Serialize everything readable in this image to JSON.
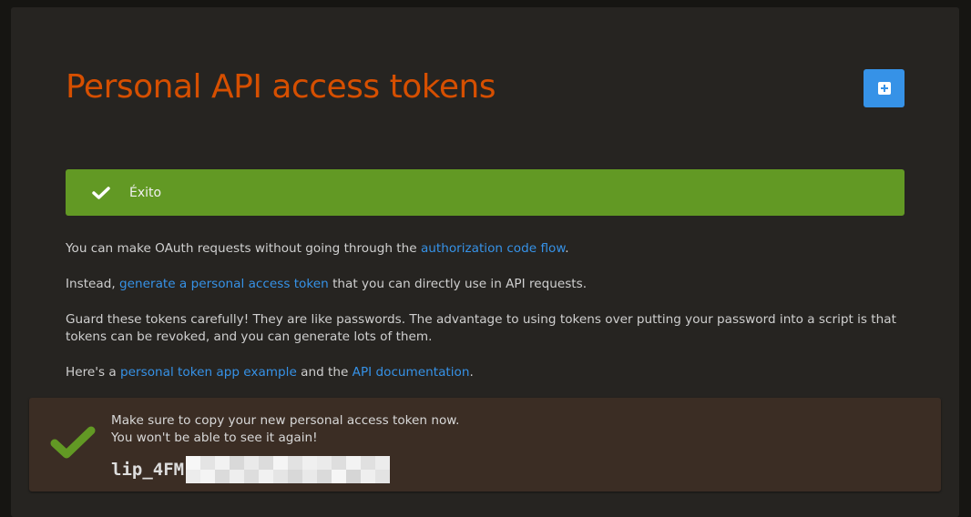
{
  "page": {
    "title": "Personal API access tokens"
  },
  "toolbar": {
    "add_icon": "plus-square-icon"
  },
  "flash": {
    "icon": "checkmark-icon",
    "text": "Éxito"
  },
  "intro": {
    "p1": {
      "before": "You can make OAuth requests without going through the ",
      "link": "authorization code flow",
      "after": "."
    },
    "p2": {
      "before": "Instead, ",
      "link": "generate a personal access token",
      "after": " that you can directly use in API requests."
    },
    "p3": "Guard these tokens carefully! They are like passwords. The advantage to using tokens over putting your password into a script is that tokens can be revoked, and you can generate lots of them.",
    "p4": {
      "before": "Here's a ",
      "link1": "personal token app example",
      "middle": " and the ",
      "link2": "API documentation",
      "after": "."
    }
  },
  "token_notice": {
    "icon": "checkmark-icon",
    "line1": "Make sure to copy your new personal access token now.",
    "line2": "You won't be able to see it again!",
    "token_prefix": "lip_4FM"
  },
  "colors": {
    "accent": "#d64f00",
    "link": "#3692e7",
    "success": "#629924",
    "button": "#3692e7"
  }
}
